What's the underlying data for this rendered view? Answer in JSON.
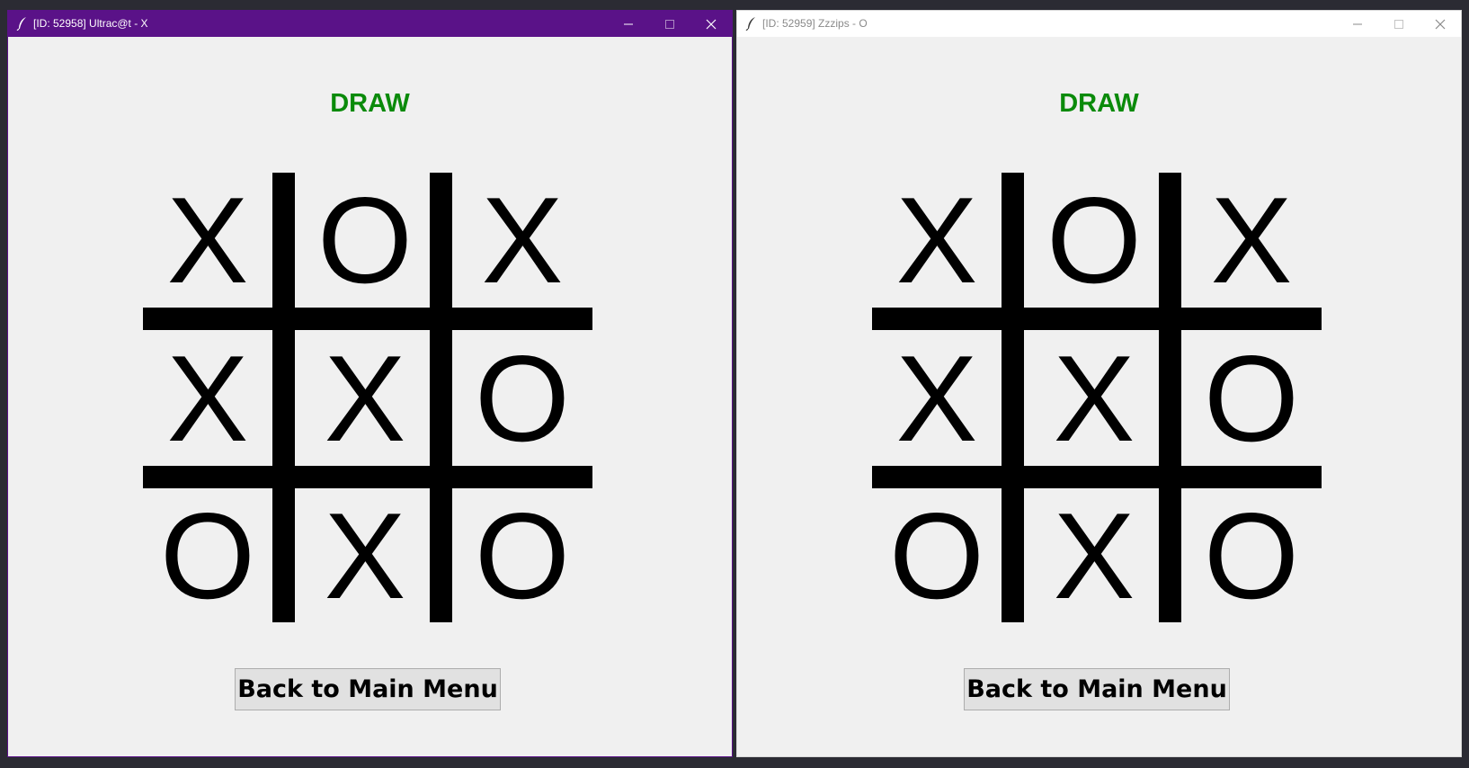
{
  "colors": {
    "active_titlebar": "#5a1288",
    "status_text": "#0a8a0a",
    "background": "#f0f0f0"
  },
  "windows": [
    {
      "title": "[ID: 52958] Ultrac@t - X",
      "active": true,
      "status": "DRAW",
      "board": [
        "X",
        "O",
        "X",
        "X",
        "X",
        "O",
        "O",
        "X",
        "O"
      ],
      "menu_button_label": "Back to Main Menu"
    },
    {
      "title": "[ID: 52959] Zzzips - O",
      "active": false,
      "status": "DRAW",
      "board": [
        "X",
        "O",
        "X",
        "X",
        "X",
        "O",
        "O",
        "X",
        "O"
      ],
      "menu_button_label": "Back to Main Menu"
    }
  ]
}
